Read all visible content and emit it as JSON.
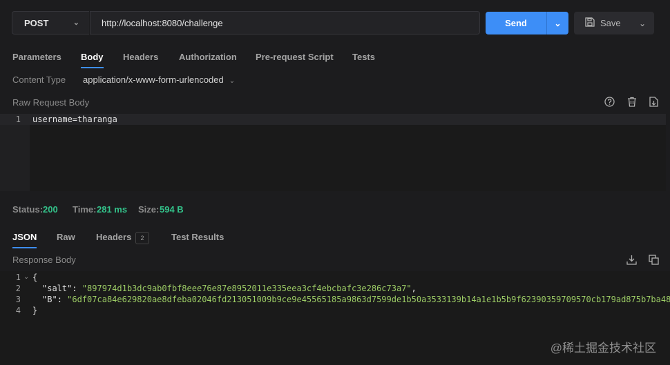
{
  "request": {
    "method": "POST",
    "url": "http://localhost:8080/challenge",
    "send_label": "Send",
    "save_label": "Save"
  },
  "tabs": [
    "Parameters",
    "Body",
    "Headers",
    "Authorization",
    "Pre-request Script",
    "Tests"
  ],
  "active_tab": "Body",
  "body": {
    "content_type_label": "Content Type",
    "content_type_value": "application/x-www-form-urlencoded",
    "raw_label": "Raw Request Body",
    "line_numbers": [
      "1"
    ],
    "lines": [
      "username=tharanga"
    ]
  },
  "status": {
    "status_label": "Status:",
    "status_value": "200",
    "time_label": "Time:",
    "time_value": "281 ms",
    "size_label": "Size:",
    "size_value": "594 B"
  },
  "response_tabs": [
    "JSON",
    "Raw",
    "Headers",
    "Test Results"
  ],
  "headers_count": "2",
  "response": {
    "label": "Response Body",
    "line_numbers": [
      "1",
      "2",
      "3",
      "4"
    ],
    "open_brace": "{",
    "close_brace": "}",
    "salt_key": "\"salt\"",
    "salt_value": "\"897974d1b3dc9ab0fbf8eee76e87e8952011e335eea3cf4ebcbafc3e286c73a7\"",
    "b_key": "\"B\"",
    "b_value": "\"6df07ca84e629820ae8dfeba02046fd213051009b9ce9e45565185a9863d7599de1b50a3533139b14a1e1b5b9f62390359709570cb179ad875b7ba48"
  },
  "watermark": "@稀土掘金技术社区",
  "colors": {
    "accent": "#3d8ef7",
    "success": "#33c28a",
    "string": "#9ccc65"
  },
  "icons": [
    "chevron-down-icon",
    "save-icon",
    "help-icon",
    "trash-icon",
    "import-icon",
    "download-icon",
    "copy-icon"
  ]
}
